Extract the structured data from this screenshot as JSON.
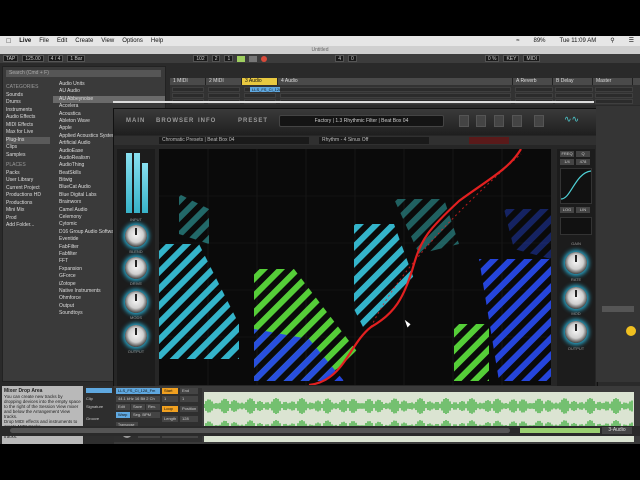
{
  "menubar": {
    "apple": "",
    "app": "Live",
    "items": [
      "File",
      "Edit",
      "Create",
      "View",
      "Options",
      "Help"
    ],
    "battery": "89%",
    "clock": "Tue 11:09 AM"
  },
  "window": {
    "title": "Untitled"
  },
  "transport": {
    "tap": "TAP",
    "tempo": "125.00",
    "meter": "4 / 4",
    "quantize": "1 Bar",
    "position": "102",
    "position2": "2",
    "position3": "1",
    "loop_len": "4",
    "loop_len2": "0",
    "cpu": "0 %",
    "key": "KEY",
    "midi": "MIDI"
  },
  "browser": {
    "search_placeholder": "Search (Cmd + F)",
    "categories_header": "CATEGORIES",
    "categories": [
      "Sounds",
      "Drums",
      "Instruments",
      "Audio Effects",
      "MIDI Effects",
      "Max for Live",
      "Plug-Ins",
      "Clips",
      "Samples"
    ],
    "places_header": "PLACES",
    "places": [
      "Packs",
      "User Library",
      "Current Project",
      "Productions HD",
      "Productions",
      "Mini Mix",
      "Prod"
    ],
    "add_folder": "Add Folder...",
    "tree": [
      "Audio Units",
      "AU Audio",
      "AU Abbeynoise",
      "Accelera",
      "Acoustica",
      "Ableton Wave",
      "Apple",
      "Applied Acoustics Systems",
      "Artificial Audio",
      "AudioEase",
      "AudioRealism",
      "AudioThing",
      "BeatSkills",
      "Bitwig",
      "BlueCat Audio",
      "Blue Digital Labs",
      "Brainworx",
      "Camel Audio",
      "Celemony",
      "Cytomic",
      "D16 Group Audio Software",
      "Eventide",
      "FabFilter",
      "Fabfilter",
      "FFT",
      "Fxpansion",
      "GForce",
      "iZotope",
      "Native Instruments",
      "Ohmforce",
      "Output",
      "Soundtoys"
    ],
    "selected_tree_item": "AU Abbeynoise"
  },
  "tracks": {
    "headers": [
      "1 MIDI",
      "2 MIDI",
      "3 Audio",
      "4 Audio",
      "A Reverb",
      "B Delay",
      "Master"
    ],
    "selected_clip": "LLS_FS_Ci_128"
  },
  "plugin": {
    "tabs": [
      "MAIN",
      "BROWSER",
      "INFO",
      "PRESET"
    ],
    "preset_name": "Factory | 1.3 Rhythmic Filter | Beat Box 04",
    "param_left": "Chromatic Presets | Beat Box 04",
    "param_mid": "Rhythm - 4 Sinus Off",
    "left_labels": [
      "INPUT",
      "BLEND",
      "DRIVE",
      "MODS",
      "OUTPUT"
    ],
    "right_labels": [
      "GAIN",
      "RATE",
      "MOD",
      "OUTPUT"
    ],
    "right_small": [
      "FREQ",
      "Q",
      "LOG",
      "LIN"
    ],
    "right_values": [
      "1/4",
      "478"
    ]
  },
  "info_view": {
    "title": "Mixer Drop Area",
    "body": "You can create new tracks by dropping devices into the empty space to the right of the Session View mixer and below the Arrangement View tracks.",
    "bullets": [
      "Drop MIDI effects and instruments to create MIDI tracks.",
      "Drop audio effects to create audio tracks."
    ]
  },
  "clip_detail": {
    "name": "LLS_FS_Ci_128_Fm",
    "sample": "LLS_FS_Ci_128",
    "rate": "44.1 kHz 16 Bit 2 Ch",
    "labels": [
      "Clip",
      "Sample",
      "Notes",
      "Signature",
      "Groove",
      "Commit",
      "Start",
      "End",
      "Loop",
      "Position",
      "Length",
      "Edit",
      "Save",
      "Rev.",
      "Warp",
      "Seg. BPM",
      "Transpose",
      "Detune",
      "Beats"
    ],
    "values": [
      "4",
      "4",
      "1",
      "1",
      "1",
      "1",
      "1",
      "128",
      "0 st",
      "0 ct",
      "0.00 dB"
    ],
    "bar_ticks": [
      "1",
      "1.2",
      "1.3",
      "1.4",
      "2",
      "2.2",
      "2.3",
      "2.4"
    ],
    "zoom": "1/8"
  },
  "status": {
    "track": "3-Audio"
  },
  "colors": {
    "accent_cyan": "#35c8dc",
    "accent_green": "#6ad63a",
    "accent_blue": "#2050e0",
    "curve_red": "#e22020",
    "waveform_green": "#2fa82f"
  }
}
